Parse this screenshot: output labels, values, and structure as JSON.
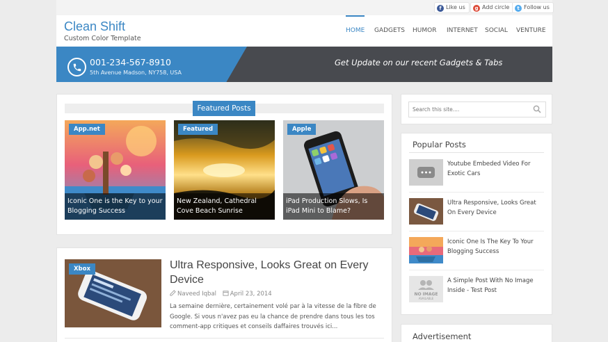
{
  "social": {
    "facebook": "Like us",
    "googleplus": "Add circle",
    "twitter": "Follow us"
  },
  "header": {
    "title": "Clean Shift",
    "subtitle": "Custom Color Template"
  },
  "nav": [
    {
      "label": "HOME"
    },
    {
      "label": "GADGETS"
    },
    {
      "label": "HUMOR"
    },
    {
      "label": "INTERNET"
    },
    {
      "label": "SOCIAL"
    },
    {
      "label": "VENTURE"
    }
  ],
  "banner": {
    "phone": "001-234-567-8910",
    "address": "5th Avenue Madson, NY758, USA",
    "tagline": "Get Update on our recent Gadgets & Tabs"
  },
  "featured": {
    "heading": "Featured Posts",
    "cards": [
      {
        "tag": "App.net",
        "caption": "Iconic One is the Key to your Blogging Success"
      },
      {
        "tag": "Featured",
        "caption": "New Zealand, Cathedral Cove Beach Sunrise"
      },
      {
        "tag": "Apple",
        "caption": "iPad Production Slows, Is iPad Mini to Blame?"
      }
    ]
  },
  "post": {
    "tag": "Xbox",
    "title": "Ultra Responsive, Looks Great on Every Device",
    "author": "Naveed Iqbal",
    "date": "April 23, 2014",
    "excerpt": "La semaine dernière, certainement volé par à la vitesse de la fibre de Google. Si vous n'avez pas eu la chance de prendre dans tous les tos comment-app critiques et conseils daffaires trouvés ici..."
  },
  "sidebar": {
    "search_placeholder": "Search this site....",
    "popular_title": "Popular Posts",
    "popular": [
      {
        "title": "Youtube Embeded Video For Exotic Cars"
      },
      {
        "title": "Ultra Responsive, Looks Great On Every Device"
      },
      {
        "title": "Iconic One Is The Key To Your Blogging Success"
      },
      {
        "title": "A Simple Post With No Image Inside - Test Post"
      }
    ],
    "no_image_label": "NO IMAGE",
    "no_image_sub": "AVAILABLE",
    "ad_title": "Advertisement"
  },
  "colors": {
    "accent": "#3b87c4",
    "banner_dark": "#484a4f",
    "facebook": "#3b5998",
    "googleplus": "#dd4b39",
    "twitter": "#55acee"
  }
}
